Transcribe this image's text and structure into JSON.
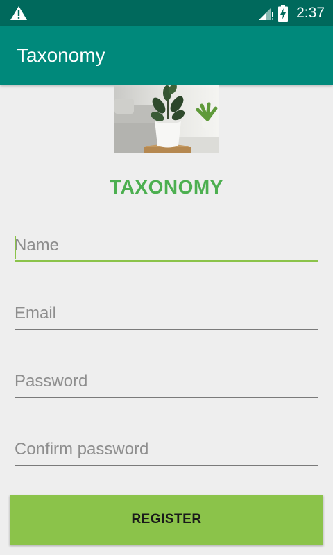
{
  "status_bar": {
    "time": "2:37",
    "icons": [
      "warning-icon",
      "cell-signal-icon",
      "battery-charging-icon"
    ]
  },
  "app_bar": {
    "title": "Taxonomy"
  },
  "hero": {
    "icon": "potted-plant-image"
  },
  "brand": {
    "title": "TAXONOMY"
  },
  "form": {
    "name_placeholder": "Name",
    "email_placeholder": "Email",
    "password_placeholder": "Password",
    "confirm_placeholder": "Confirm password",
    "register_label": "REGISTER"
  },
  "colors": {
    "status_bar": "#00695c",
    "app_bar": "#00897b",
    "accent": "#8bc34a",
    "brand_title": "#4caf50",
    "background": "#eeeeee"
  }
}
